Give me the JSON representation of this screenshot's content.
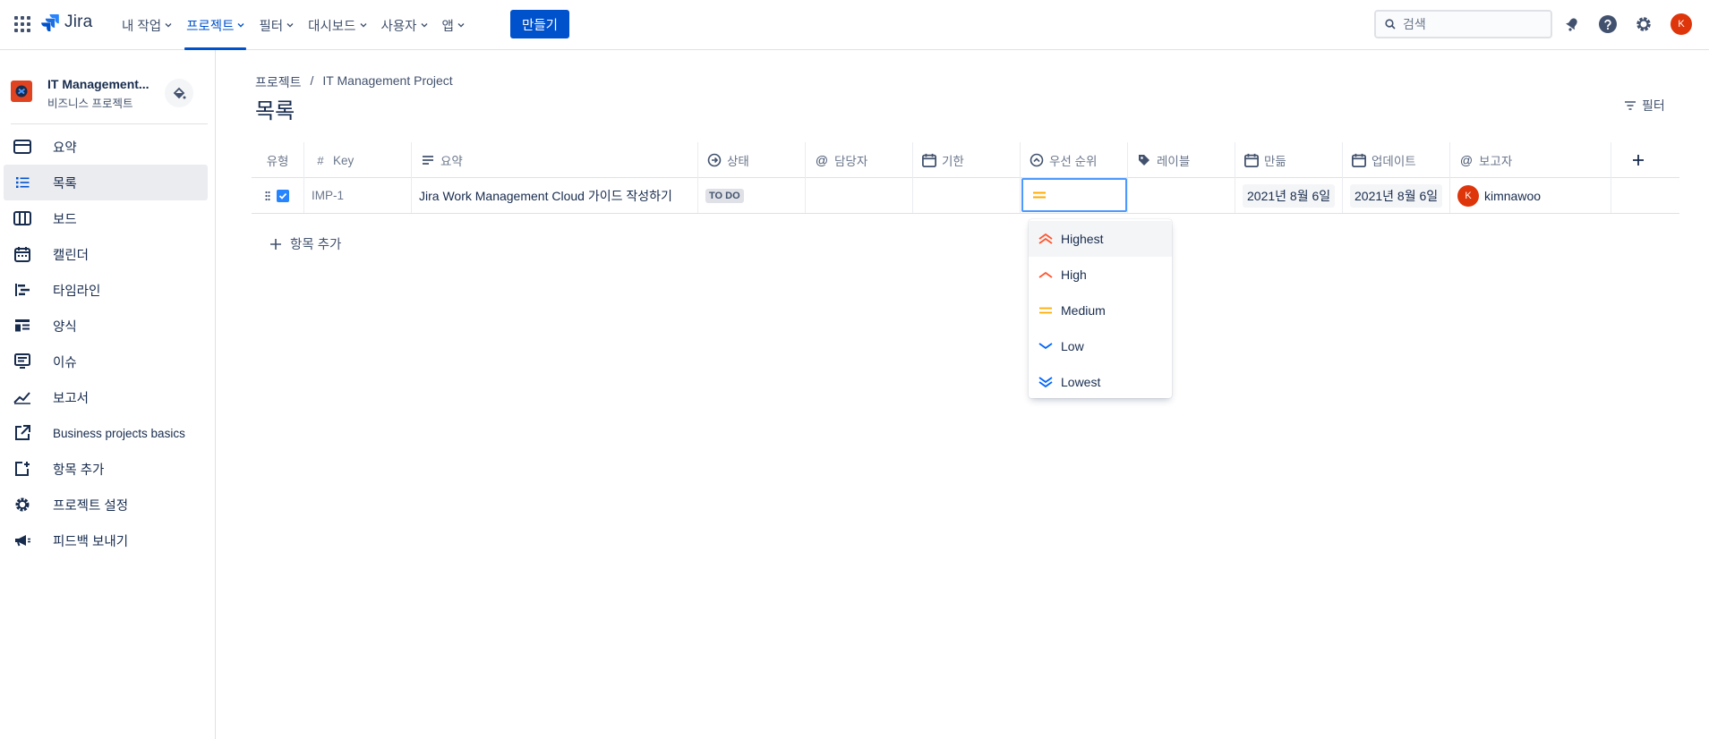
{
  "app": {
    "logo_text": "Jira"
  },
  "nav": {
    "items": [
      {
        "label": "내 작업"
      },
      {
        "label": "프로젝트",
        "active": true
      },
      {
        "label": "필터"
      },
      {
        "label": "대시보드"
      },
      {
        "label": "사용자"
      },
      {
        "label": "앱"
      }
    ],
    "create_label": "만들기",
    "search_placeholder": "검색",
    "user_initial": "K"
  },
  "sidebar": {
    "project_name": "IT Management...",
    "project_type": "비즈니스 프로젝트",
    "items": [
      {
        "label": "요약",
        "icon": "summary-icon"
      },
      {
        "label": "목록",
        "icon": "list-icon",
        "active": true
      },
      {
        "label": "보드",
        "icon": "board-icon"
      },
      {
        "label": "캘린더",
        "icon": "calendar-icon"
      },
      {
        "label": "타임라인",
        "icon": "timeline-icon"
      },
      {
        "label": "양식",
        "icon": "form-icon"
      },
      {
        "label": "이슈",
        "icon": "issues-icon"
      },
      {
        "label": "보고서",
        "icon": "reports-icon"
      },
      {
        "label": "Business projects basics",
        "icon": "external-link-icon"
      },
      {
        "label": "항목 추가",
        "icon": "add-item-icon"
      },
      {
        "label": "프로젝트 설정",
        "icon": "settings-icon"
      },
      {
        "label": "피드백 보내기",
        "icon": "megaphone-icon"
      }
    ]
  },
  "main": {
    "breadcrumb": {
      "root": "프로젝트",
      "separator": "/",
      "current": "IT Management Project"
    },
    "title": "목록",
    "filter_label": "필터",
    "columns": {
      "type": "유형",
      "key": "Key",
      "summary": "요약",
      "status": "상태",
      "assignee": "담당자",
      "due": "기한",
      "priority": "우선 순위",
      "labels": "레이블",
      "created": "만듦",
      "updated": "업데이트",
      "reporter": "보고자"
    },
    "row": {
      "key": "IMP-1",
      "summary": "Jira Work Management Cloud 가이드 작성하기",
      "status": "TO DO",
      "assignee": "",
      "due": "",
      "priority": "Medium",
      "labels": "",
      "created": "2021년 8월 6일",
      "updated": "2021년 8월 6일",
      "reporter_initial": "K",
      "reporter_name": "kimnawoo"
    },
    "add_item_label": "항목 추가"
  },
  "priority_dropdown": {
    "options": [
      {
        "label": "Highest",
        "color": "#ff5630"
      },
      {
        "label": "High",
        "color": "#ff5630"
      },
      {
        "label": "Medium",
        "color": "#ffab00"
      },
      {
        "label": "Low",
        "color": "#0065ff"
      },
      {
        "label": "Lowest",
        "color": "#0065ff"
      }
    ]
  },
  "colors": {
    "accent": "#0052cc",
    "avatar": "#de350b",
    "focus": "#4c9aff"
  }
}
